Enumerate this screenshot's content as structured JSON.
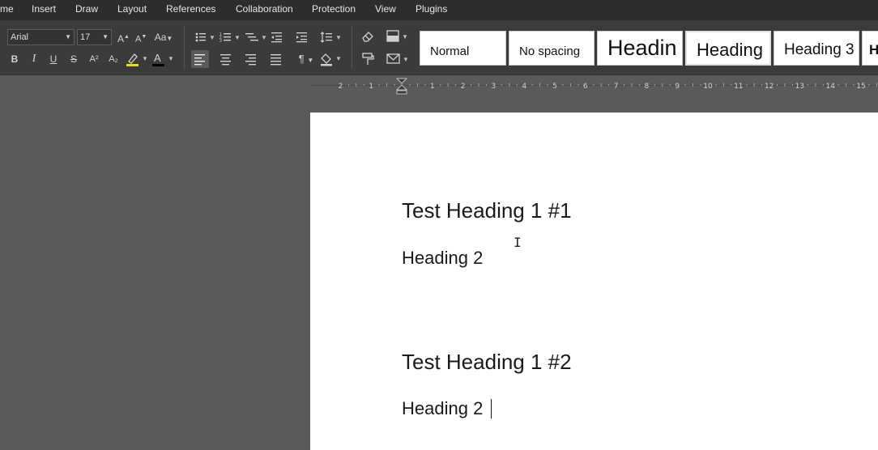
{
  "menu": {
    "items": [
      "me",
      "Insert",
      "Draw",
      "Layout",
      "References",
      "Collaboration",
      "Protection",
      "View",
      "Plugins"
    ]
  },
  "toolbar": {
    "font_name": "Arial",
    "font_size": "17",
    "styles": [
      "Normal",
      "No spacing",
      "Headin",
      "Heading",
      "Heading 3",
      "H"
    ],
    "icons": {
      "increase_font": "A",
      "decrease_font": "A",
      "change_case": "Aa",
      "bold": "B",
      "italic": "I",
      "underline": "U",
      "strikethrough": "S",
      "superscript": "A²",
      "subscript": "A₂",
      "highlight_color": "#f0e000",
      "font_color": "#000000",
      "paragraph_mark": "¶"
    }
  },
  "ruler": {
    "numbers": [
      "2",
      "1",
      "1",
      "2",
      "3",
      "4",
      "5",
      "6",
      "7",
      "8",
      "9",
      "10",
      "11",
      "12",
      "13",
      "14",
      "15"
    ]
  },
  "document": {
    "heading1_a": "Test Heading 1 #1",
    "heading2_a": "Heading 2",
    "heading1_b": "Test Heading 1 #2",
    "heading2_b": "Heading 2"
  }
}
